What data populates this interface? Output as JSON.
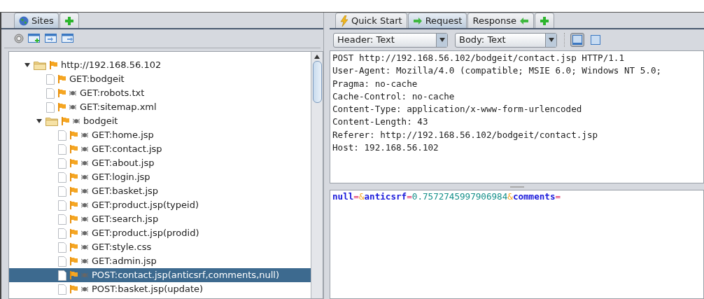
{
  "left_tabs": [
    {
      "label": "Sites",
      "kind": "globe",
      "selected": true
    },
    {
      "kind": "add",
      "selected": false
    }
  ],
  "tree": [
    {
      "label": "http://192.168.56.102",
      "kind": "folder",
      "spider": false,
      "expanded": true,
      "selected": false,
      "children": [
        {
          "label": "GET:bodgeit",
          "kind": "file",
          "spider": false,
          "selected": false
        },
        {
          "label": "GET:robots.txt",
          "kind": "file",
          "spider": true,
          "selected": false
        },
        {
          "label": "GET:sitemap.xml",
          "kind": "file",
          "spider": true,
          "selected": false
        },
        {
          "label": "bodgeit",
          "kind": "folder",
          "spider": true,
          "expanded": true,
          "selected": false,
          "children": [
            {
              "label": "GET:home.jsp",
              "kind": "file",
              "spider": true,
              "selected": false
            },
            {
              "label": "GET:contact.jsp",
              "kind": "file",
              "spider": true,
              "selected": false
            },
            {
              "label": "GET:about.jsp",
              "kind": "file",
              "spider": true,
              "selected": false
            },
            {
              "label": "GET:login.jsp",
              "kind": "file",
              "spider": true,
              "selected": false
            },
            {
              "label": "GET:basket.jsp",
              "kind": "file",
              "spider": true,
              "selected": false
            },
            {
              "label": "GET:product.jsp(typeid)",
              "kind": "file",
              "spider": true,
              "selected": false
            },
            {
              "label": "GET:search.jsp",
              "kind": "file",
              "spider": true,
              "selected": false
            },
            {
              "label": "GET:product.jsp(prodid)",
              "kind": "file",
              "spider": true,
              "selected": false
            },
            {
              "label": "GET:style.css",
              "kind": "file",
              "spider": true,
              "selected": false
            },
            {
              "label": "GET:admin.jsp",
              "kind": "file",
              "spider": true,
              "selected": false
            },
            {
              "label": "POST:contact.jsp(anticsrf,comments,null)",
              "kind": "file",
              "spider": true,
              "selected": true
            },
            {
              "label": "POST:basket.jsp(update)",
              "kind": "file",
              "spider": true,
              "selected": false
            }
          ]
        }
      ]
    }
  ],
  "right_tabs": [
    {
      "label": "Quick Start",
      "kind": "bolt",
      "selected": false
    },
    {
      "label": "Request",
      "kind": "arrow-right",
      "selected": true
    },
    {
      "label": "Response",
      "kind": "arrow-left",
      "selected": false
    },
    {
      "kind": "add",
      "selected": false
    }
  ],
  "header_view": {
    "value": "Header: Text"
  },
  "body_view": {
    "value": "Body: Text"
  },
  "layout_buttons": [
    {
      "kind": "split",
      "selected": true
    },
    {
      "kind": "single",
      "selected": false
    }
  ],
  "header_lines": [
    "POST http://192.168.56.102/bodgeit/contact.jsp HTTP/1.1",
    "User-Agent: Mozilla/4.0 (compatible; MSIE 6.0; Windows NT 5.0;",
    "Pragma: no-cache",
    "Cache-Control: no-cache",
    "Content-Type: application/x-www-form-urlencoded",
    "Content-Length: 43",
    "Referer: http://192.168.56.102/bodgeit/contact.jsp",
    "Host: 192.168.56.102"
  ],
  "body_tokens": [
    {
      "kind": "name",
      "text": "null"
    },
    {
      "kind": "eq",
      "text": "="
    },
    {
      "kind": "amp",
      "text": "&"
    },
    {
      "kind": "name",
      "text": "anticsrf"
    },
    {
      "kind": "eq",
      "text": "="
    },
    {
      "kind": "value",
      "text": "0.7572745997906984"
    },
    {
      "kind": "amp",
      "text": "&"
    },
    {
      "kind": "name",
      "text": "comments"
    },
    {
      "kind": "eq",
      "text": "="
    }
  ]
}
